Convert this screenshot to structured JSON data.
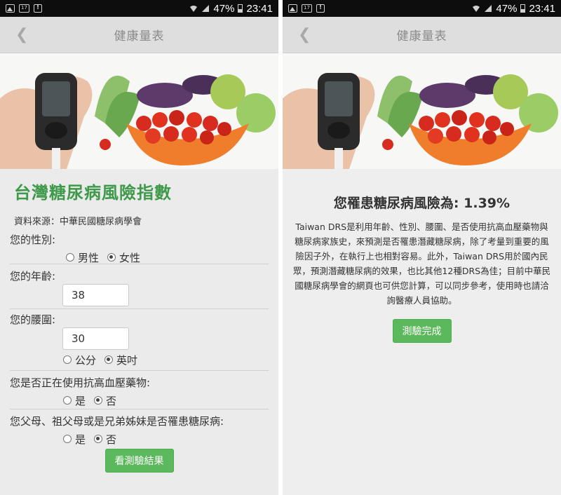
{
  "status_bar": {
    "battery": "47%",
    "time": "23:41"
  },
  "app_title": "健康量表",
  "form": {
    "heading": "台灣糖尿病風險指數",
    "source": "資料來源：中華民國糖尿病學會",
    "gender": {
      "label": "您的性別:",
      "options": [
        "男性",
        "女性"
      ],
      "selected": "女性"
    },
    "age": {
      "label": "您的年齡:",
      "value": "38"
    },
    "waist": {
      "label": "您的腰圍:",
      "value": "30",
      "options": [
        "公分",
        "英吋"
      ],
      "selected": "英吋"
    },
    "bp_med": {
      "label": "您是否正在使用抗高血壓藥物:",
      "options": [
        "是",
        "否"
      ],
      "selected": "否"
    },
    "family": {
      "label": "您父母、祖父母或是兄弟姊妹是否罹患糖尿病:",
      "options": [
        "是",
        "否"
      ],
      "selected": "否"
    },
    "submit_label": "看測驗結果"
  },
  "result": {
    "title": "您罹患糖尿病風險為: 1.39%",
    "description": "Taiwan DRS是利用年齡、性別、腰圍、是否使用抗高血壓藥物與糖尿病家族史，來預測是否罹患潛藏糖尿病，除了考量到重要的風險因子外，在執行上也相對容易。此外，Taiwan DRS用於國內民眾，預測潛藏糖尿病的效果，也比其他12種DRS為佳；目前中華民國糖尿病學會的網頁也可供您計算，可以同步參考，使用時也請洽詢醫療人員協助。",
    "done_label": "測驗完成"
  },
  "icons": [
    "image-icon",
    "calendar-icon",
    "alert-icon",
    "wifi-icon",
    "signal-icon",
    "battery-icon",
    "back-chevron-icon",
    "radio-icon"
  ],
  "colors": {
    "accent_green": "#3e9a4a",
    "button_green": "#5cb85c",
    "appbar": "#dedede"
  }
}
